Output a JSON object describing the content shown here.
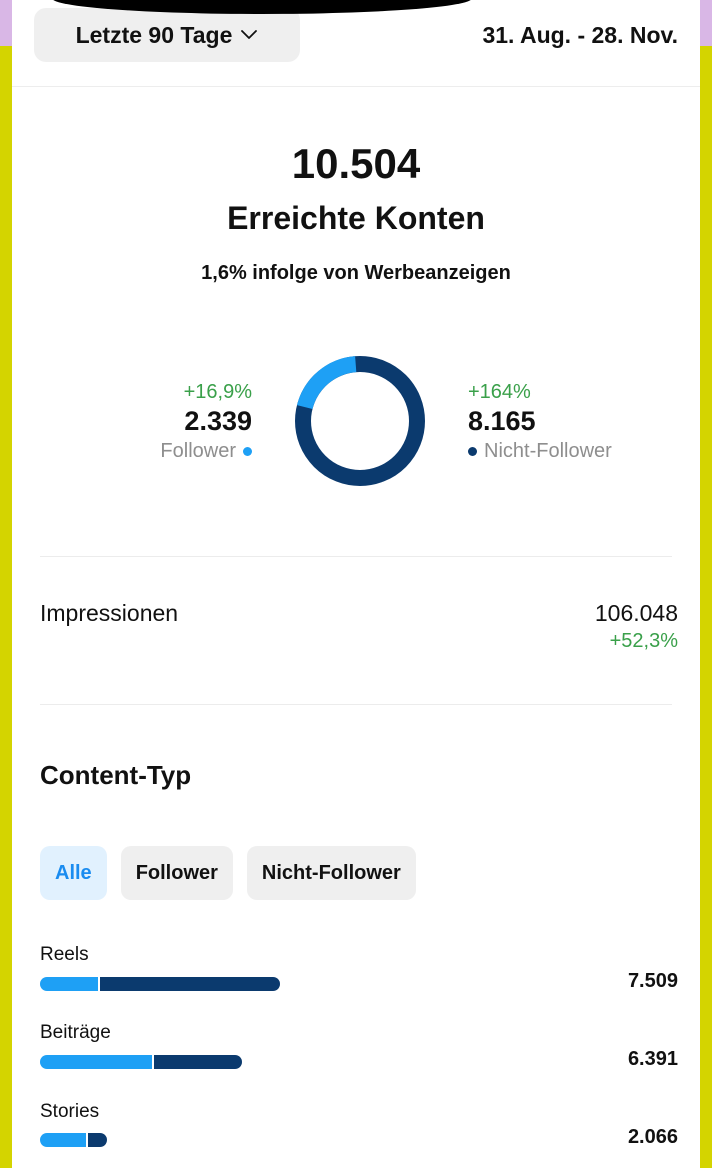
{
  "header": {
    "range_label": "Letzte 90 Tage",
    "date_range": "31. Aug. - 28. Nov."
  },
  "summary": {
    "total": "10.504",
    "title": "Erreichte Konten",
    "ads_note": "1,6% infolge von Werbeanzeigen"
  },
  "followers": {
    "change": "+16,9%",
    "count": "2.339",
    "label": "Follower",
    "value": 2339,
    "color": "#1ea0f5"
  },
  "non_followers": {
    "change": "+164%",
    "count": "8.165",
    "label": "Nicht-Follower",
    "value": 8165,
    "color": "#0b3a6e"
  },
  "impressions": {
    "label": "Impressionen",
    "value": "106.048",
    "change": "+52,3%"
  },
  "content": {
    "title": "Content-Typ",
    "filters": [
      "Alle",
      "Follower",
      "Nicht-Follower"
    ],
    "active_filter": "Alle",
    "rows": [
      {
        "label": "Reels",
        "value": "7.509",
        "follower_share": 0.245
      },
      {
        "label": "Beiträge",
        "value": "6.391",
        "follower_share": 0.56
      },
      {
        "label": "Stories",
        "value": "2.066",
        "follower_share": 0.7
      }
    ]
  },
  "colors": {
    "positive": "#3aa04a",
    "follower": "#1ea0f5",
    "non_follower": "#0b3a6e"
  }
}
